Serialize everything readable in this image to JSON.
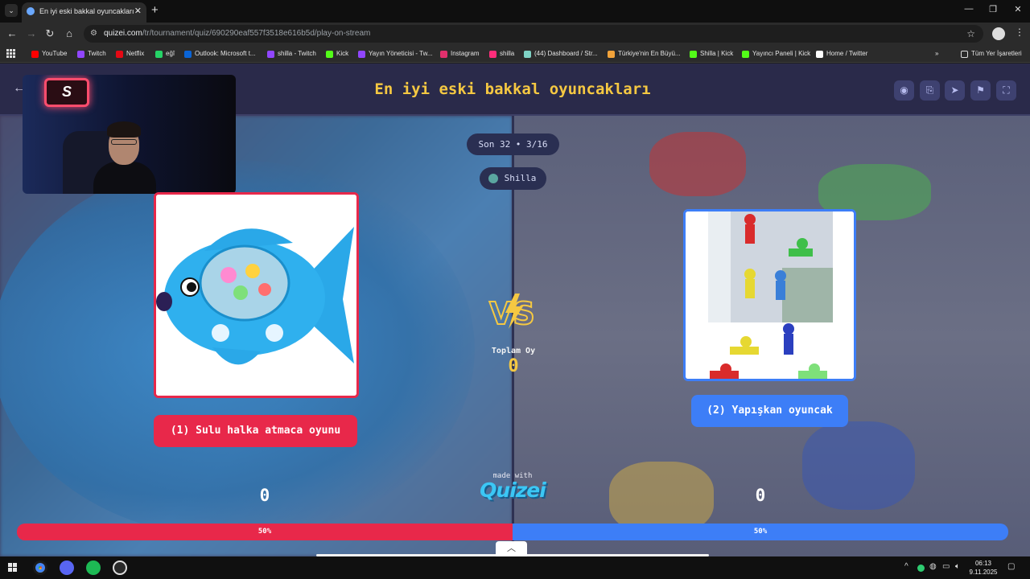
{
  "browser": {
    "tab_title": "En iyi eski bakkal oyuncakları -",
    "url_host": "quizei.com",
    "url_path": "/tr/tournament/quiz/690290eaf557f3518e616b5d/play-on-stream"
  },
  "bookmarks": [
    {
      "label": "YouTube",
      "color": "#ff0000"
    },
    {
      "label": "Twitch",
      "color": "#9146ff"
    },
    {
      "label": "Netflix",
      "color": "#e50914"
    },
    {
      "label": "eğî",
      "color": "#25d366"
    },
    {
      "label": "Outlook: Microsoft t...",
      "color": "#0a64d6"
    },
    {
      "label": "shilla - Twitch",
      "color": "#9146ff"
    },
    {
      "label": "Kick",
      "color": "#53fc18"
    },
    {
      "label": "Yayın Yöneticisi - Tw...",
      "color": "#9146ff"
    },
    {
      "label": "Instagram",
      "color": "#e1306c"
    },
    {
      "label": "shilla",
      "color": "#ff2d7a"
    },
    {
      "label": "(44) Dashboard / Str...",
      "color": "#7fd3c5"
    },
    {
      "label": "Türkiye'nin En Büyü...",
      "color": "#f2a33a"
    },
    {
      "label": "Shilla | Kick",
      "color": "#53fc18"
    },
    {
      "label": "Yayıncı Paneli | Kick",
      "color": "#53fc18"
    },
    {
      "label": "Home / Twitter",
      "color": "#ffffff"
    }
  ],
  "all_bookmarks": "Tüm Yer İşaretleri",
  "quiz": {
    "title": "En iyi eski bakkal oyuncakları",
    "round": "Son 32 • 3/16",
    "user": "Shilla",
    "total_label": "Toplam Oy",
    "total_votes": "0",
    "made_with": "made with",
    "brand": "Quizei"
  },
  "options": {
    "left": {
      "label": "(1) Sulu halka atmaca oyunu",
      "votes": "0",
      "percent_label": "50%",
      "share": 0.5,
      "color": "#e8284a"
    },
    "right": {
      "label": "(2) Yapışkan oyuncak",
      "votes": "0",
      "percent_label": "50%",
      "share": 0.5,
      "color": "#3d7ef7"
    }
  },
  "taskbar": {
    "time": "06:13",
    "date": "9.11.2025"
  }
}
